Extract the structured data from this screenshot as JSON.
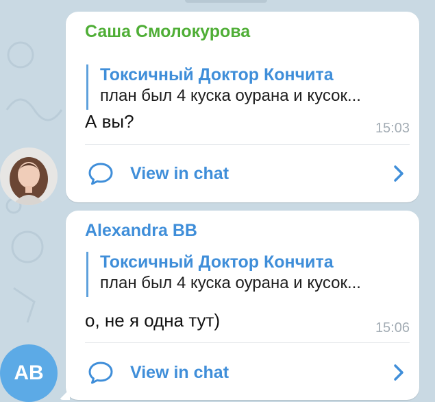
{
  "messages": [
    {
      "sender": "Саша Смолокурова",
      "sender_color": "#4fae36",
      "reply_author": "Токсичный Доктор Кончита",
      "reply_text": "план был 4 куска оурана и кусок...",
      "text": "А вы?",
      "time": "15:03",
      "view_label": "View in chat",
      "avatar_icon": "user-photo"
    },
    {
      "sender": "Alexandra BB",
      "sender_color": "#3f8ed9",
      "reply_author": "Токсичный Доктор Кончита",
      "reply_text": "план был 4 куска оурана и кусок...",
      "text": "о, не я одна тут)",
      "time": "15:06",
      "view_label": "View in chat",
      "avatar_initials": "AB",
      "avatar_color": "#5caae6"
    }
  ],
  "colors": {
    "background": "#c9d9e3",
    "accent": "#3f8ed9",
    "reply_bar": "#5da0dc",
    "time": "#a3acb4"
  }
}
